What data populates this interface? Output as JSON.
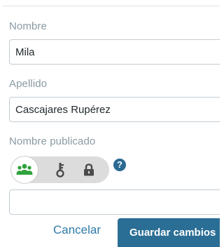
{
  "form": {
    "first_name": {
      "label": "Nombre",
      "value": "Mila"
    },
    "last_name": {
      "label": "Apellido",
      "value": "Cascajares Rupérez"
    },
    "display_name": {
      "label": "Nombre publicado",
      "value": "",
      "visibility_options": [
        {
          "icon": "group-icon",
          "selected": true
        },
        {
          "icon": "key-icon",
          "selected": false
        },
        {
          "icon": "lock-icon",
          "selected": false
        }
      ],
      "help": "?"
    }
  },
  "actions": {
    "cancel_label": "Cancelar",
    "save_label": "Guardar cambios"
  },
  "colors": {
    "label_text": "#8a9aa2",
    "input_border": "#c3ccd2",
    "accent_green": "#2fa23b",
    "icon_gray": "#4a4a4a",
    "toggle_bg": "#dcdcdc",
    "primary_button": "#2b6e95",
    "link": "#2f7aa8"
  }
}
